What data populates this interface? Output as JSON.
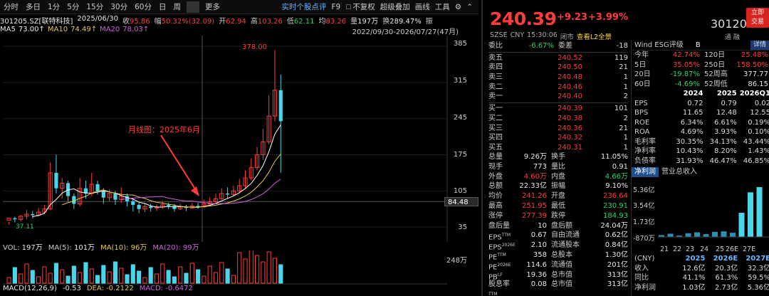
{
  "toolbar": {
    "periods": [
      "分时",
      "多日",
      "1分",
      "5分",
      "15分",
      "30分",
      "60分",
      "日",
      "周",
      "更多"
    ],
    "right_items": [
      "实时个股点评",
      "F9",
      "不复权",
      "超级叠加",
      "画线",
      "工具"
    ]
  },
  "info": {
    "code_name": "301205.SZ[联特科技]",
    "date": "2025/06/30",
    "close_k": "收",
    "close_v": "95.86",
    "amp_k": "幅",
    "amp_v": "50.32%(32.09)",
    "open_k": "开",
    "open_v": "62.94",
    "high_k": "高",
    "high_v": "103.26",
    "low_k": "低",
    "low_v": "62.11",
    "avg_k": "均",
    "avg_v": "83.26",
    "vol_k": "量",
    "vol_v": "197万",
    "turn_k": "换",
    "turn_v": "289.47%",
    "more": "振"
  },
  "ma": {
    "ma5_k": "MA5",
    "ma5_v": "73.00↑",
    "ma10_k": "MA10",
    "ma10_v": "74.49↑",
    "ma20_k": "MA20",
    "ma20_v": "78.03↑",
    "range": "2022/09/30-2026/07/27(47月)"
  },
  "price_axis": [
    "385",
    "315",
    "245",
    "175",
    "105",
    "35"
  ],
  "price_tag": "84.48",
  "max_label": "378.00",
  "min_label": "37.11",
  "annotation": "月线图：2025年6月",
  "volume": {
    "vol_k": "VOL:",
    "vol_v": "197万",
    "ma5_k": "MA(5):",
    "ma5_v": "101万",
    "ma10_k": "MA(10):",
    "ma10_v": "96万",
    "ma20_k": "MA(20):",
    "ma20_v": "99万",
    "axis_top": "248万"
  },
  "macd": {
    "label": "MACD(12,26,9)",
    "diff_v": "-0.53",
    "dea_k": "DEA:",
    "dea_v": "-0.2122",
    "macd_k": "MACD:",
    "macd_v": "-0.6472"
  },
  "quote": {
    "price": "240.39",
    "change": "+9.23",
    "pct": "+3.99%",
    "code": "301205",
    "trade_btn_l1": "立即",
    "trade_btn_l2": "交易",
    "tonghua": "通 融",
    "market": "SZSE",
    "currency": "CNY",
    "time": "15:30:06",
    "status": "闭市",
    "l2": "查看L2全景"
  },
  "book": {
    "header": {
      "k1": "委比",
      "v1": "-6.67%",
      "k2": "委差",
      "v2": "-18"
    },
    "asks": [
      {
        "label": "卖五",
        "price": "240.52",
        "vol": "119"
      },
      {
        "label": "卖四",
        "price": "240.50",
        "vol": "21"
      },
      {
        "label": "卖三",
        "price": "240.48",
        "vol": "1"
      },
      {
        "label": "卖二",
        "price": "240.46",
        "vol": "1"
      },
      {
        "label": "卖一",
        "price": "240.40",
        "vol": "2"
      }
    ],
    "bids": [
      {
        "label": "买一",
        "price": "240.39",
        "vol": "101"
      },
      {
        "label": "买二",
        "price": "240.38",
        "vol": "2"
      },
      {
        "label": "买三",
        "price": "240.36",
        "vol": "21"
      },
      {
        "label": "买四",
        "price": "240.32",
        "vol": "1"
      },
      {
        "label": "买五",
        "price": "240.31",
        "vol": "1"
      }
    ]
  },
  "stats": [
    {
      "k1": "总量",
      "v1": "9.26万",
      "c1": "white",
      "k2": "换手",
      "v2": "11.05%",
      "c2": "white"
    },
    {
      "k1": "现手",
      "v1": "773",
      "c1": "white",
      "k2": "量比",
      "v2": "0.91",
      "c2": "white"
    },
    {
      "k1": "外盘",
      "v1": "4.60万",
      "c1": "red",
      "k2": "内盘",
      "v2": "4.66万",
      "c2": "green"
    },
    {
      "k1": "总额",
      "v1": "22.33亿",
      "c1": "white",
      "k2": "振幅",
      "v2": "9.10%",
      "c2": "white"
    },
    {
      "k1": "均价",
      "v1": "241.26",
      "c1": "red",
      "k2": "开盘",
      "v2": "236.64",
      "c2": "red"
    },
    {
      "k1": "最高",
      "v1": "251.95",
      "c1": "red",
      "k2": "最低",
      "v2": "230.91",
      "c2": "green"
    },
    {
      "k1": "涨停",
      "v1": "277.39",
      "c1": "red",
      "k2": "跌停",
      "v2": "184.93",
      "c2": "green"
    },
    {
      "k1": "盘后量",
      "v1": "10",
      "c1": "white",
      "k2": "盘后额",
      "v2": "24.04万",
      "c2": "white"
    },
    {
      "k1": "EPS",
      "k1sup": "TTM",
      "v1": "0.67",
      "c1": "white",
      "k2": "自由流通",
      "v2": "0.62亿",
      "c2": "white"
    },
    {
      "k1": "EPS",
      "k1sup": "2026E",
      "v1": "2.10",
      "c1": "white",
      "k2": "流通股本",
      "v2": "0.84亿",
      "c2": "white"
    },
    {
      "k1": "PE",
      "k1sup": "TTM",
      "v1": "358",
      "c1": "white",
      "k2": "总股本",
      "v2": "1.30亿",
      "c2": "white"
    },
    {
      "k1": "PE",
      "k1sup": "2026E",
      "v1": "114.6",
      "c1": "white",
      "k2": "流通值",
      "v2": "201亿",
      "c2": "white"
    },
    {
      "k1": "PB",
      "k1sup": "LF",
      "v1": "19.36",
      "c1": "white",
      "k2": "总市值",
      "v2": "313亿",
      "c2": "white"
    },
    {
      "k1": "股息率",
      "k1sup": "TTM",
      "v1": "0.08",
      "c1": "white",
      "k2": "总市值",
      "v2": "313亿",
      "c2": "white"
    }
  ],
  "esg": {
    "label": "Wind ESG评级",
    "rating": "B",
    "detail": "详情"
  },
  "perf": [
    {
      "k1": "今年",
      "v1": "42.74%",
      "c1": "red",
      "k2": "120日",
      "v2": "25.48%",
      "c2": "red"
    },
    {
      "k1": "5日",
      "v1": "35.05%",
      "c1": "red",
      "k2": "250日",
      "v2": "158.50%",
      "c2": "red"
    },
    {
      "k1": "20日",
      "v1": "-19.87%",
      "c1": "green",
      "k2": "52周高",
      "v2": "377.77",
      "c2": "white"
    },
    {
      "k1": "60日",
      "v1": "-4.69%",
      "c1": "green",
      "k2": "52周低",
      "v2": "86.15",
      "c2": "white"
    }
  ],
  "fund": {
    "years": [
      "2024",
      "2025",
      "2026Q1"
    ],
    "rows": [
      {
        "k": "EPS",
        "v": [
          "0.72",
          "0.79",
          "0.02"
        ]
      },
      {
        "k": "BPS",
        "v": [
          "11.65",
          "12.48",
          "12.55"
        ]
      },
      {
        "k": "ROE",
        "v": [
          "6.34%",
          "6.61%",
          "0.19%"
        ]
      },
      {
        "k": "ROA",
        "v": [
          "4.69%",
          "3.93%",
          "0.10%"
        ]
      },
      {
        "k": "毛利率",
        "v": [
          "30.35%",
          "34.13%",
          "43.44%"
        ]
      },
      {
        "k": "净利率",
        "v": [
          "10.43%",
          "8.20%",
          "1.43%"
        ]
      },
      {
        "k": "负债率",
        "v": [
          "31.93%",
          "46.47%",
          "46.85%"
        ]
      }
    ]
  },
  "np": {
    "tab1": "净利润",
    "tab2": "营业总收入",
    "y_labels": [
      "5.36亿",
      "3.54亿",
      "1.73亿",
      "-870万"
    ],
    "x_labels": [
      "21",
      "22",
      "23",
      "24",
      "25",
      "26E",
      "27E"
    ],
    "bar_values": [
      0.2,
      0.35,
      0.15,
      0.4,
      0.5,
      0.3,
      0.55,
      0.6,
      0.45,
      2.6,
      4.8,
      5.36
    ],
    "y_max": 5.36,
    "y_min": -0.087
  },
  "forecast": {
    "currency": "(CNY)",
    "years": [
      "2025",
      "2026E",
      "2027E"
    ],
    "rows": [
      {
        "k": "收入",
        "v": [
          "12.6亿",
          "20.3亿",
          "32.3亿"
        ],
        "c": "white"
      },
      {
        "k": "同比",
        "v": [
          "41.1%",
          "61.3%",
          "59.5%"
        ],
        "c": "red"
      },
      {
        "k": "净利润",
        "v": [
          "1.03亿",
          "2.73亿",
          "5.36亿"
        ],
        "c": "white"
      }
    ]
  },
  "colors": {
    "up": "#ff3b3b",
    "down": "#29d36b",
    "candle_up": "#ff3b3b",
    "candle_down": "#4ad6e8",
    "ma5": "#ffffff",
    "ma10": "#e6c84a",
    "ma20": "#d060e0"
  },
  "chart_data": {
    "type": "candlestick",
    "y_range": [
      20,
      392
    ],
    "candles": [
      [
        48,
        52,
        45,
        40
      ],
      [
        52,
        50,
        55,
        44
      ],
      [
        50,
        56,
        58,
        46
      ],
      [
        56,
        60,
        68,
        50
      ],
      [
        60,
        58,
        66,
        52
      ],
      [
        58,
        64,
        72,
        55
      ],
      [
        64,
        70,
        78,
        60
      ],
      [
        70,
        140,
        160,
        68
      ],
      [
        140,
        110,
        175,
        100
      ],
      [
        110,
        120,
        130,
        90
      ],
      [
        120,
        95,
        125,
        85
      ],
      [
        95,
        80,
        100,
        70
      ],
      [
        80,
        110,
        130,
        75
      ],
      [
        110,
        100,
        125,
        90
      ],
      [
        100,
        118,
        140,
        95
      ],
      [
        118,
        105,
        125,
        98
      ],
      [
        105,
        92,
        110,
        80
      ],
      [
        92,
        100,
        108,
        85
      ],
      [
        100,
        88,
        105,
        78
      ],
      [
        88,
        95,
        112,
        82
      ],
      [
        95,
        85,
        100,
        75
      ],
      [
        85,
        78,
        90,
        65
      ],
      [
        78,
        70,
        82,
        62
      ],
      [
        70,
        75,
        80,
        64
      ],
      [
        75,
        72,
        80,
        65
      ],
      [
        72,
        74,
        79,
        66
      ],
      [
        74,
        78,
        84,
        70
      ],
      [
        78,
        76,
        82,
        70
      ],
      [
        76,
        70,
        80,
        65
      ],
      [
        70,
        74,
        80,
        68
      ],
      [
        74,
        72,
        78,
        66
      ],
      [
        72,
        76,
        82,
        70
      ],
      [
        76,
        74,
        82,
        70
      ],
      [
        74,
        80,
        88,
        72
      ],
      [
        80,
        84,
        92,
        78
      ],
      [
        84,
        90,
        100,
        82
      ],
      [
        90,
        100,
        110,
        88
      ],
      [
        100,
        98,
        112,
        90
      ],
      [
        98,
        105,
        115,
        95
      ],
      [
        105,
        115,
        128,
        100
      ],
      [
        115,
        130,
        145,
        110
      ],
      [
        130,
        150,
        168,
        125
      ],
      [
        150,
        175,
        190,
        145
      ],
      [
        175,
        200,
        225,
        165
      ],
      [
        200,
        250,
        290,
        195
      ],
      [
        250,
        300,
        378,
        240
      ],
      [
        300,
        240,
        330,
        140
      ]
    ]
  }
}
